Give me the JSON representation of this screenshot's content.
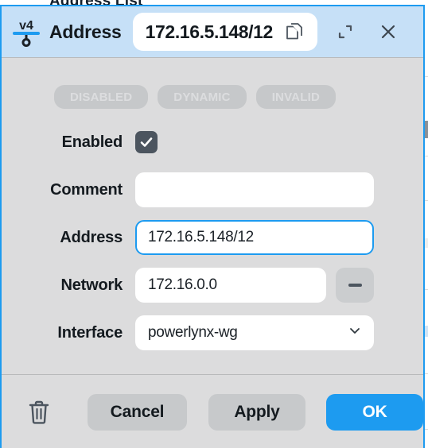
{
  "backdrop": {
    "title": "Address List"
  },
  "titlebar": {
    "icon": "ipv4-icon",
    "title": "Address",
    "value": "172.16.5.148/12",
    "copy_icon": "copy-icon",
    "restore_icon": "restore-icon",
    "close_icon": "close-icon"
  },
  "badges": [
    {
      "label": "DISABLED"
    },
    {
      "label": "DYNAMIC"
    },
    {
      "label": "INVALID"
    }
  ],
  "form": {
    "enabled": {
      "label": "Enabled",
      "checked": true,
      "check_glyph": "check-icon"
    },
    "comment": {
      "label": "Comment",
      "value": "",
      "placeholder": ""
    },
    "address": {
      "label": "Address",
      "value": "172.16.5.148/12",
      "focused": true
    },
    "network": {
      "label": "Network",
      "value": "172.16.0.0",
      "minus_icon": "minus-icon"
    },
    "interface": {
      "label": "Interface",
      "value": "powerlynx-wg",
      "chevron_icon": "chevron-down-icon"
    }
  },
  "footer": {
    "delete_icon": "trash-icon",
    "cancel_label": "Cancel",
    "apply_label": "Apply",
    "ok_label": "OK"
  },
  "colors": {
    "accent": "#1d9bf0",
    "titlebar_bg": "#c6e0f7",
    "dialog_bg": "#dcdcdd",
    "badge_bg": "#c6c8ca",
    "badge_text": "#dcdddf",
    "button_bg": "#c7c9cb",
    "checkbox_bg": "#4c555f"
  }
}
